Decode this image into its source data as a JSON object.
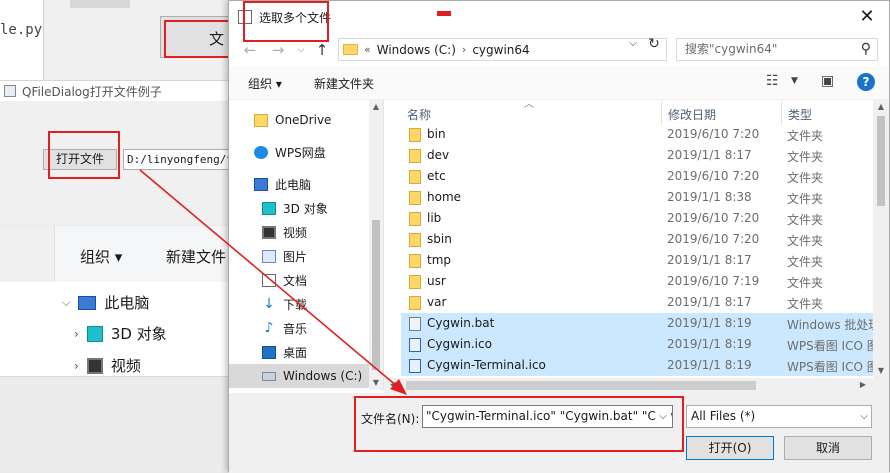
{
  "background": {
    "code_text": "le.py",
    "top_button_label": "文",
    "qt_window": {
      "title": "QFileDialog打开文件例子",
      "open_button_label": "打开文件",
      "path_value": "D:/linyongfeng/te"
    },
    "explorer": {
      "organize_label": "组织 ▾",
      "new_folder_label": "新建文件",
      "tree": [
        "此电脑",
        "3D 对象",
        "视频"
      ]
    }
  },
  "dialog": {
    "title": "选取多个文件",
    "address": {
      "prefix": "«",
      "crumbs": [
        "Windows (C:)",
        "cygwin64"
      ]
    },
    "search_placeholder": "搜索\"cygwin64\"",
    "toolbar": {
      "organize_label": "组织 ▾",
      "new_folder_label": "新建文件夹"
    },
    "nav_pane": [
      {
        "label": "OneDrive",
        "icon": "folder-icon"
      },
      {
        "label": "WPS网盘",
        "icon": "cloud-icon"
      },
      {
        "label": "此电脑",
        "icon": "pc-icon"
      },
      {
        "label": "3D 对象",
        "icon": "3d-objects-icon"
      },
      {
        "label": "视频",
        "icon": "video-icon"
      },
      {
        "label": "图片",
        "icon": "picture-icon"
      },
      {
        "label": "文档",
        "icon": "document-icon"
      },
      {
        "label": "下载",
        "icon": "download-icon"
      },
      {
        "label": "音乐",
        "icon": "music-icon"
      },
      {
        "label": "桌面",
        "icon": "desktop-icon"
      },
      {
        "label": "Windows (C:)",
        "icon": "drive-icon"
      }
    ],
    "columns": {
      "name": "名称",
      "date": "修改日期",
      "type": "类型"
    },
    "files": [
      {
        "name": "bin",
        "date": "2019/6/10 7:20",
        "type": "文件夹",
        "kind": "dir",
        "selected": false
      },
      {
        "name": "dev",
        "date": "2019/1/1 8:17",
        "type": "文件夹",
        "kind": "dir",
        "selected": false
      },
      {
        "name": "etc",
        "date": "2019/6/10 7:20",
        "type": "文件夹",
        "kind": "dir",
        "selected": false
      },
      {
        "name": "home",
        "date": "2019/1/1 8:38",
        "type": "文件夹",
        "kind": "dir",
        "selected": false
      },
      {
        "name": "lib",
        "date": "2019/6/10 7:20",
        "type": "文件夹",
        "kind": "dir",
        "selected": false
      },
      {
        "name": "sbin",
        "date": "2019/6/10 7:20",
        "type": "文件夹",
        "kind": "dir",
        "selected": false
      },
      {
        "name": "tmp",
        "date": "2019/1/1 8:17",
        "type": "文件夹",
        "kind": "dir",
        "selected": false
      },
      {
        "name": "usr",
        "date": "2019/6/10 7:19",
        "type": "文件夹",
        "kind": "dir",
        "selected": false
      },
      {
        "name": "var",
        "date": "2019/1/1 8:17",
        "type": "文件夹",
        "kind": "dir",
        "selected": false
      },
      {
        "name": "Cygwin.bat",
        "date": "2019/1/1 8:19",
        "type": "Windows 批处理",
        "kind": "bat",
        "selected": true
      },
      {
        "name": "Cygwin.ico",
        "date": "2019/1/1 8:19",
        "type": "WPS看图 ICO 图",
        "kind": "ico",
        "selected": true
      },
      {
        "name": "Cygwin-Terminal.ico",
        "date": "2019/1/1 8:19",
        "type": "WPS看图 ICO 图",
        "kind": "ico",
        "selected": true
      }
    ],
    "filename_label": "文件名(N):",
    "filename_value": "\"Cygwin-Terminal.ico\" \"Cygwin.bat\" \"Cygwin.ico\"",
    "filter_value": "All Files (*)",
    "open_label": "打开(O)",
    "cancel_label": "取消"
  },
  "colors": {
    "annotation": "#e02020",
    "selection": "#cce8ff",
    "accent": "#0078d7"
  }
}
